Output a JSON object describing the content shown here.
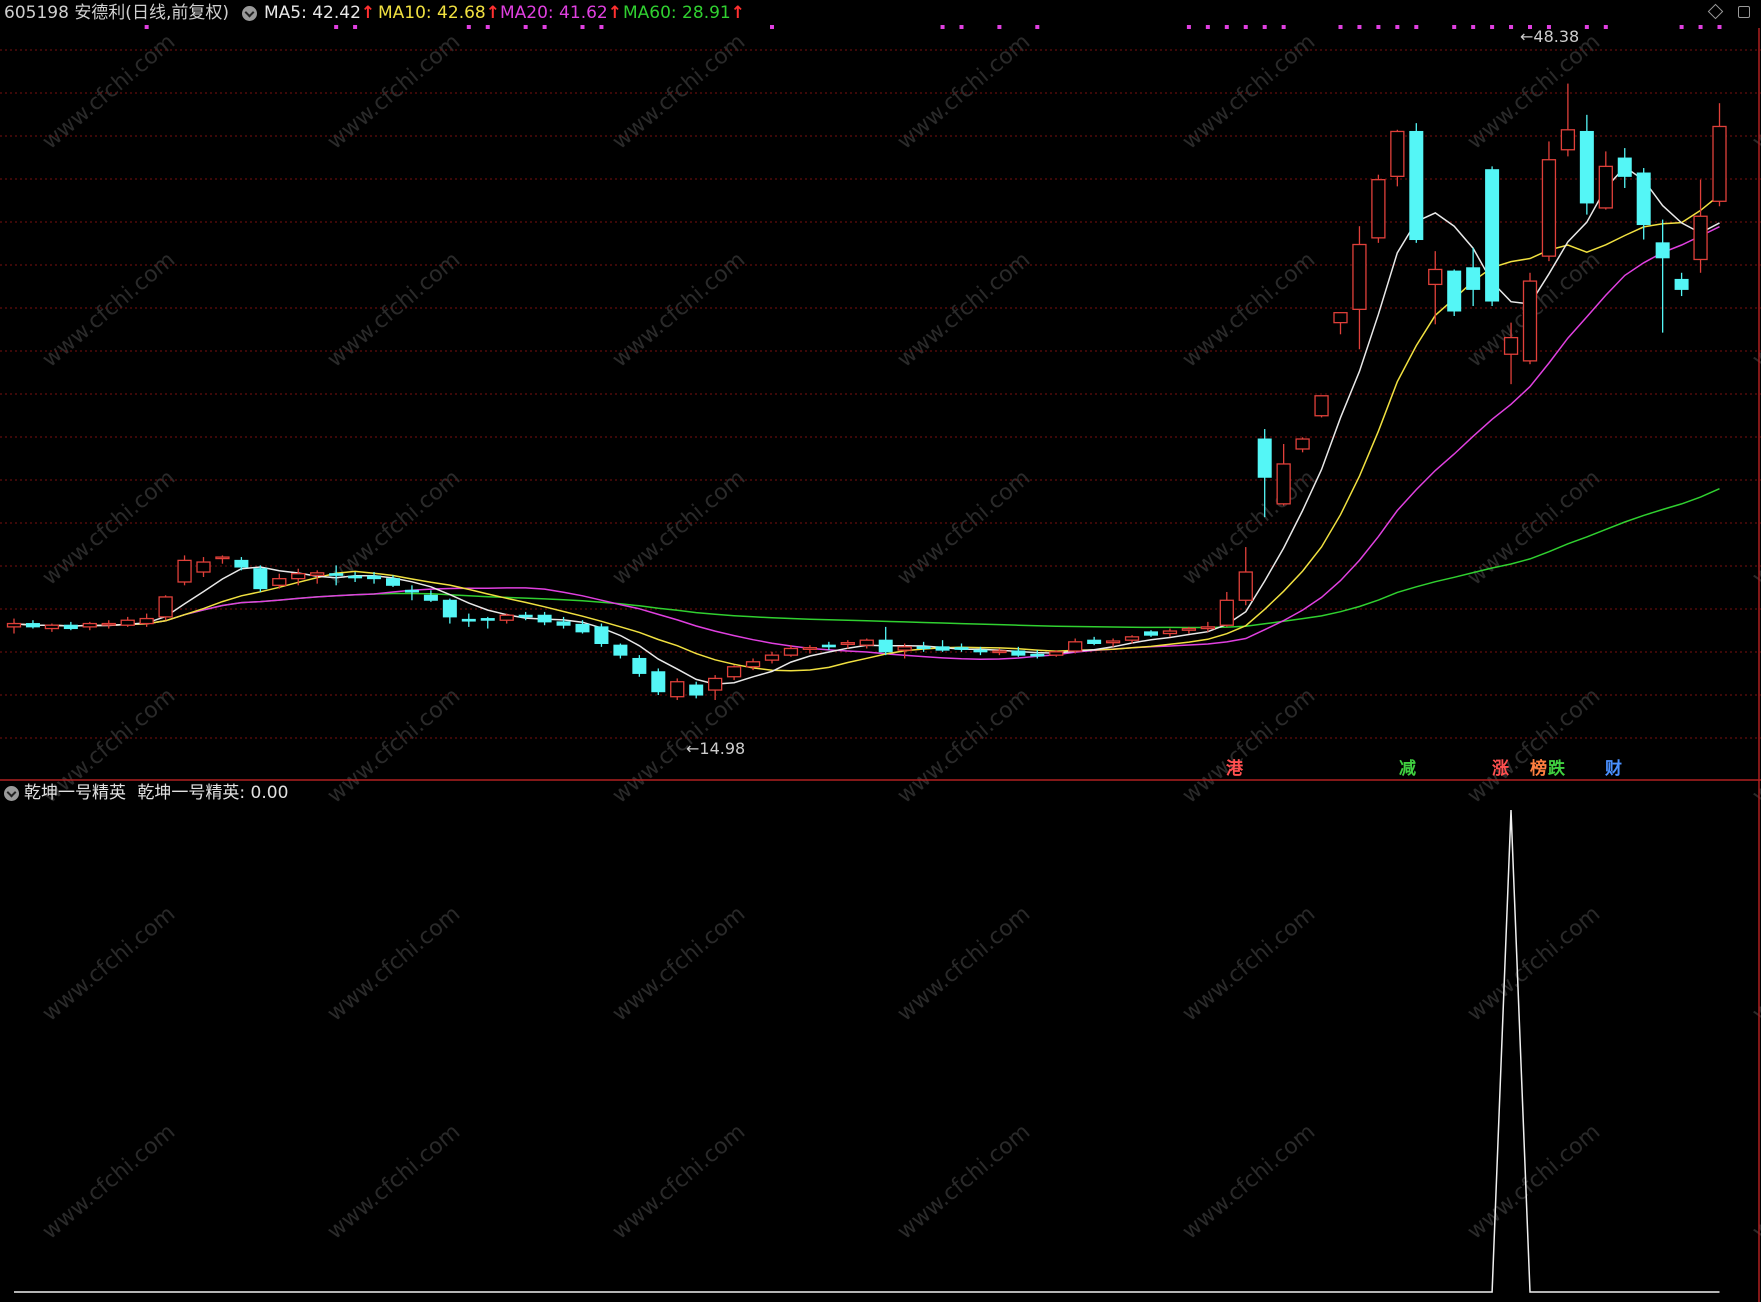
{
  "header": {
    "stock_code": "605198",
    "stock_name": "安德利(日线,前复权)",
    "ma": [
      {
        "label": "MA5: 42.42",
        "color": "#e8e8e8"
      },
      {
        "label": "MA10: 42.68",
        "color": "#f0e040"
      },
      {
        "label": "MA20: 41.62",
        "color": "#e040e0"
      },
      {
        "label": "MA60: 28.91",
        "color": "#30d030"
      }
    ],
    "arrow_glyph": "↑"
  },
  "annotations": {
    "high_label": "48.38",
    "low_label": "14.98"
  },
  "badges": [
    {
      "text": "港",
      "color": "#ff5050"
    },
    {
      "text": "减",
      "color": "#40d040"
    },
    {
      "text": "涨",
      "color": "#ff5050"
    },
    {
      "text": "榜",
      "color": "#ff8040"
    },
    {
      "text": "跌",
      "color": "#40d040"
    },
    {
      "text": "财",
      "color": "#4a90ff"
    }
  ],
  "indicator": {
    "name": "乾坤一号精英",
    "value_label": "乾坤一号精英: 0.00"
  },
  "watermark": "www.cfchi.com",
  "colors": {
    "up": "#e0403a",
    "down": "#54f6f6",
    "grid": "#7a1010",
    "separator": "#b02020",
    "ma5": "#e8e8e8",
    "ma10": "#f0e040",
    "ma20": "#e040e0",
    "ma60": "#30d030",
    "signal_dot": "#e040e0"
  },
  "chart_data": {
    "type": "candlestick",
    "series": [
      {
        "o": 15.7,
        "h": 16.2,
        "l": 15.3,
        "c": 15.9
      },
      {
        "o": 15.9,
        "h": 16.1,
        "l": 15.6,
        "c": 15.7
      },
      {
        "o": 15.6,
        "h": 15.9,
        "l": 15.4,
        "c": 15.8
      },
      {
        "o": 15.8,
        "h": 16.0,
        "l": 15.5,
        "c": 15.6
      },
      {
        "o": 15.7,
        "h": 16.0,
        "l": 15.5,
        "c": 15.9
      },
      {
        "o": 15.85,
        "h": 16.1,
        "l": 15.6,
        "c": 15.9
      },
      {
        "o": 15.8,
        "h": 16.3,
        "l": 15.7,
        "c": 16.1
      },
      {
        "o": 15.9,
        "h": 16.5,
        "l": 15.7,
        "c": 16.2
      },
      {
        "o": 16.3,
        "h": 17.6,
        "l": 16.1,
        "c": 17.5
      },
      {
        "o": 18.4,
        "h": 20.0,
        "l": 18.2,
        "c": 19.7
      },
      {
        "o": 19.0,
        "h": 19.9,
        "l": 18.7,
        "c": 19.6
      },
      {
        "o": 19.85,
        "h": 20.0,
        "l": 19.5,
        "c": 19.9
      },
      {
        "o": 19.7,
        "h": 19.9,
        "l": 19.1,
        "c": 19.3
      },
      {
        "o": 19.2,
        "h": 19.4,
        "l": 17.8,
        "c": 18.0
      },
      {
        "o": 18.2,
        "h": 18.9,
        "l": 18.0,
        "c": 18.6
      },
      {
        "o": 18.6,
        "h": 19.2,
        "l": 18.2,
        "c": 18.9
      },
      {
        "o": 18.8,
        "h": 19.1,
        "l": 18.3,
        "c": 18.95
      },
      {
        "o": 18.9,
        "h": 19.4,
        "l": 18.2,
        "c": 18.8
      },
      {
        "o": 18.75,
        "h": 19.0,
        "l": 18.4,
        "c": 18.65
      },
      {
        "o": 18.75,
        "h": 19.0,
        "l": 18.3,
        "c": 18.6
      },
      {
        "o": 18.6,
        "h": 18.8,
        "l": 18.1,
        "c": 18.2
      },
      {
        "o": 17.9,
        "h": 18.2,
        "l": 17.3,
        "c": 17.8
      },
      {
        "o": 17.6,
        "h": 17.9,
        "l": 17.2,
        "c": 17.3
      },
      {
        "o": 17.3,
        "h": 17.4,
        "l": 15.9,
        "c": 16.3
      },
      {
        "o": 16.15,
        "h": 16.5,
        "l": 15.7,
        "c": 16.05
      },
      {
        "o": 16.2,
        "h": 16.3,
        "l": 15.6,
        "c": 16.1
      },
      {
        "o": 16.1,
        "h": 16.5,
        "l": 15.9,
        "c": 16.4
      },
      {
        "o": 16.4,
        "h": 16.6,
        "l": 16.1,
        "c": 16.3
      },
      {
        "o": 16.4,
        "h": 16.6,
        "l": 15.8,
        "c": 16.0
      },
      {
        "o": 16.0,
        "h": 16.3,
        "l": 15.6,
        "c": 15.8
      },
      {
        "o": 15.85,
        "h": 16.1,
        "l": 15.3,
        "c": 15.4
      },
      {
        "o": 15.7,
        "h": 15.9,
        "l": 14.5,
        "c": 14.7
      },
      {
        "o": 14.6,
        "h": 14.7,
        "l": 13.8,
        "c": 14.0
      },
      {
        "o": 13.8,
        "h": 14.0,
        "l": 12.7,
        "c": 12.9
      },
      {
        "o": 13.0,
        "h": 13.2,
        "l": 11.6,
        "c": 11.8
      },
      {
        "o": 11.5,
        "h": 12.6,
        "l": 11.3,
        "c": 12.4
      },
      {
        "o": 12.2,
        "h": 12.4,
        "l": 11.4,
        "c": 11.6
      },
      {
        "o": 11.9,
        "h": 12.8,
        "l": 11.3,
        "c": 12.6
      },
      {
        "o": 12.7,
        "h": 13.4,
        "l": 12.5,
        "c": 13.3
      },
      {
        "o": 13.3,
        "h": 13.8,
        "l": 13.1,
        "c": 13.6
      },
      {
        "o": 13.7,
        "h": 14.2,
        "l": 13.5,
        "c": 14.0
      },
      {
        "o": 14.0,
        "h": 14.6,
        "l": 13.9,
        "c": 14.4
      },
      {
        "o": 14.35,
        "h": 14.6,
        "l": 14.1,
        "c": 14.45
      },
      {
        "o": 14.6,
        "h": 14.8,
        "l": 14.3,
        "c": 14.5
      },
      {
        "o": 14.65,
        "h": 14.9,
        "l": 14.4,
        "c": 14.75
      },
      {
        "o": 14.6,
        "h": 15.0,
        "l": 14.4,
        "c": 14.9
      },
      {
        "o": 14.9,
        "h": 15.7,
        "l": 14.0,
        "c": 14.2
      },
      {
        "o": 14.3,
        "h": 14.7,
        "l": 13.8,
        "c": 14.5
      },
      {
        "o": 14.5,
        "h": 14.8,
        "l": 14.2,
        "c": 14.4
      },
      {
        "o": 14.5,
        "h": 14.9,
        "l": 14.2,
        "c": 14.3
      },
      {
        "o": 14.45,
        "h": 14.7,
        "l": 14.2,
        "c": 14.35
      },
      {
        "o": 14.3,
        "h": 14.5,
        "l": 14.0,
        "c": 14.2
      },
      {
        "o": 14.2,
        "h": 14.4,
        "l": 14.0,
        "c": 14.25
      },
      {
        "o": 14.25,
        "h": 14.5,
        "l": 13.9,
        "c": 14.0
      },
      {
        "o": 14.05,
        "h": 14.3,
        "l": 13.8,
        "c": 13.95
      },
      {
        "o": 14.0,
        "h": 14.3,
        "l": 13.9,
        "c": 14.2
      },
      {
        "o": 14.25,
        "h": 15.0,
        "l": 14.1,
        "c": 14.8
      },
      {
        "o": 14.9,
        "h": 15.1,
        "l": 14.6,
        "c": 14.7
      },
      {
        "o": 14.75,
        "h": 15.0,
        "l": 14.5,
        "c": 14.85
      },
      {
        "o": 14.9,
        "h": 15.2,
        "l": 14.7,
        "c": 15.1
      },
      {
        "o": 15.4,
        "h": 15.5,
        "l": 15.1,
        "c": 15.2
      },
      {
        "o": 15.3,
        "h": 15.6,
        "l": 15.1,
        "c": 15.45
      },
      {
        "o": 15.5,
        "h": 15.7,
        "l": 15.3,
        "c": 15.6
      },
      {
        "o": 15.6,
        "h": 16.0,
        "l": 15.4,
        "c": 15.7
      },
      {
        "o": 15.8,
        "h": 17.8,
        "l": 15.7,
        "c": 17.3
      },
      {
        "o": 17.3,
        "h": 20.5,
        "l": 17.0,
        "c": 19.0
      },
      {
        "o": 27.0,
        "h": 27.6,
        "l": 22.3,
        "c": 24.7
      },
      {
        "o": 23.1,
        "h": 26.7,
        "l": 23.0,
        "c": 25.5
      },
      {
        "o": 26.4,
        "h": 27.1,
        "l": 26.2,
        "c": 27.0
      },
      {
        "o": 28.4,
        "h": 29.6,
        "l": 28.3,
        "c": 29.6
      },
      {
        "o": 34.0,
        "h": 34.6,
        "l": 33.3,
        "c": 34.6
      },
      {
        "o": 34.8,
        "h": 39.8,
        "l": 32.4,
        "c": 38.7
      },
      {
        "o": 39.1,
        "h": 42.9,
        "l": 38.8,
        "c": 42.6
      },
      {
        "o": 42.8,
        "h": 45.6,
        "l": 42.2,
        "c": 45.5
      },
      {
        "o": 45.5,
        "h": 46.0,
        "l": 38.8,
        "c": 39.0
      },
      {
        "o": 36.3,
        "h": 38.3,
        "l": 33.9,
        "c": 37.2
      },
      {
        "o": 37.1,
        "h": 37.2,
        "l": 34.4,
        "c": 34.7
      },
      {
        "o": 37.3,
        "h": 38.5,
        "l": 35.0,
        "c": 36.0
      },
      {
        "o": 43.2,
        "h": 43.4,
        "l": 35.0,
        "c": 35.3
      },
      {
        "o": 32.1,
        "h": 34.0,
        "l": 30.3,
        "c": 33.1
      },
      {
        "o": 31.7,
        "h": 37.0,
        "l": 31.5,
        "c": 36.5
      },
      {
        "o": 38.0,
        "h": 44.9,
        "l": 37.7,
        "c": 43.8
      },
      {
        "o": 44.4,
        "h": 48.38,
        "l": 44.0,
        "c": 45.6
      },
      {
        "o": 45.5,
        "h": 46.5,
        "l": 40.5,
        "c": 41.2
      },
      {
        "o": 40.9,
        "h": 44.3,
        "l": 40.8,
        "c": 43.4
      },
      {
        "o": 43.9,
        "h": 44.5,
        "l": 42.1,
        "c": 42.8
      },
      {
        "o": 43.0,
        "h": 43.3,
        "l": 39.0,
        "c": 39.9
      },
      {
        "o": 38.8,
        "h": 40.2,
        "l": 33.4,
        "c": 37.9
      },
      {
        "o": 36.6,
        "h": 37.0,
        "l": 35.6,
        "c": 36.0
      },
      {
        "o": 37.8,
        "h": 42.6,
        "l": 37.0,
        "c": 40.4
      },
      {
        "o": 41.3,
        "h": 47.2,
        "l": 41.0,
        "c": 45.8
      }
    ],
    "ylim": [
      10.7,
      50.4
    ],
    "indicator_values": [
      0,
      0,
      0,
      0,
      0,
      0,
      0,
      0,
      0,
      0,
      0,
      0,
      0,
      0,
      0,
      0,
      0,
      0,
      0,
      0,
      0,
      0,
      0,
      0,
      0,
      0,
      0,
      0,
      0,
      0,
      0,
      0,
      0,
      0,
      0,
      0,
      0,
      0,
      0,
      0,
      0,
      0,
      0,
      0,
      0,
      0,
      0,
      0,
      0,
      0,
      0,
      0,
      0,
      0,
      0,
      0,
      0,
      0,
      0,
      0,
      0,
      0,
      0,
      0,
      0,
      0,
      0,
      0,
      0,
      0,
      0,
      0,
      0,
      0,
      0,
      0,
      0,
      0,
      0,
      1,
      0,
      0,
      0,
      0,
      0,
      0,
      0,
      0,
      0,
      0,
      0
    ],
    "signal_days": [
      7,
      17,
      18,
      24,
      25,
      27,
      28,
      30,
      31,
      40,
      49,
      50,
      52,
      54,
      62,
      63,
      64,
      65,
      66,
      67,
      70,
      71,
      72,
      73,
      74,
      76,
      77,
      78,
      79,
      80,
      81,
      83,
      84,
      88,
      89,
      90
    ]
  }
}
